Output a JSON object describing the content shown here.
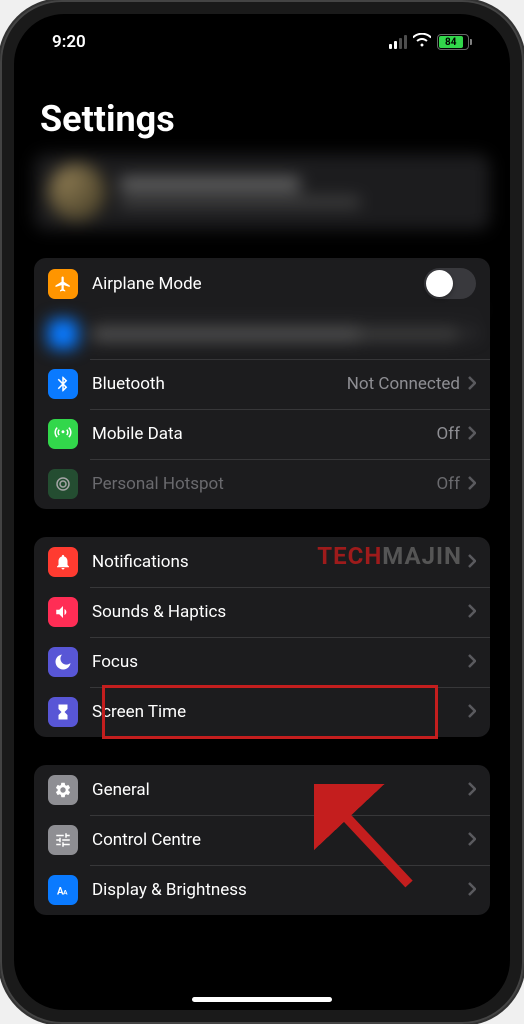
{
  "status": {
    "time": "9:20",
    "battery_pct": "84"
  },
  "page_title": "Settings",
  "group1": {
    "airplane": "Airplane Mode",
    "bluetooth": "Bluetooth",
    "bluetooth_value": "Not Connected",
    "mobile_data": "Mobile Data",
    "mobile_data_value": "Off",
    "hotspot": "Personal Hotspot",
    "hotspot_value": "Off"
  },
  "group2": {
    "notifications": "Notifications",
    "sounds": "Sounds & Haptics",
    "focus": "Focus",
    "screen_time": "Screen Time"
  },
  "group3": {
    "general": "General",
    "control_centre": "Control Centre",
    "display": "Display & Brightness"
  },
  "watermark": {
    "part1": "TECH",
    "part2": "MAJIN"
  }
}
